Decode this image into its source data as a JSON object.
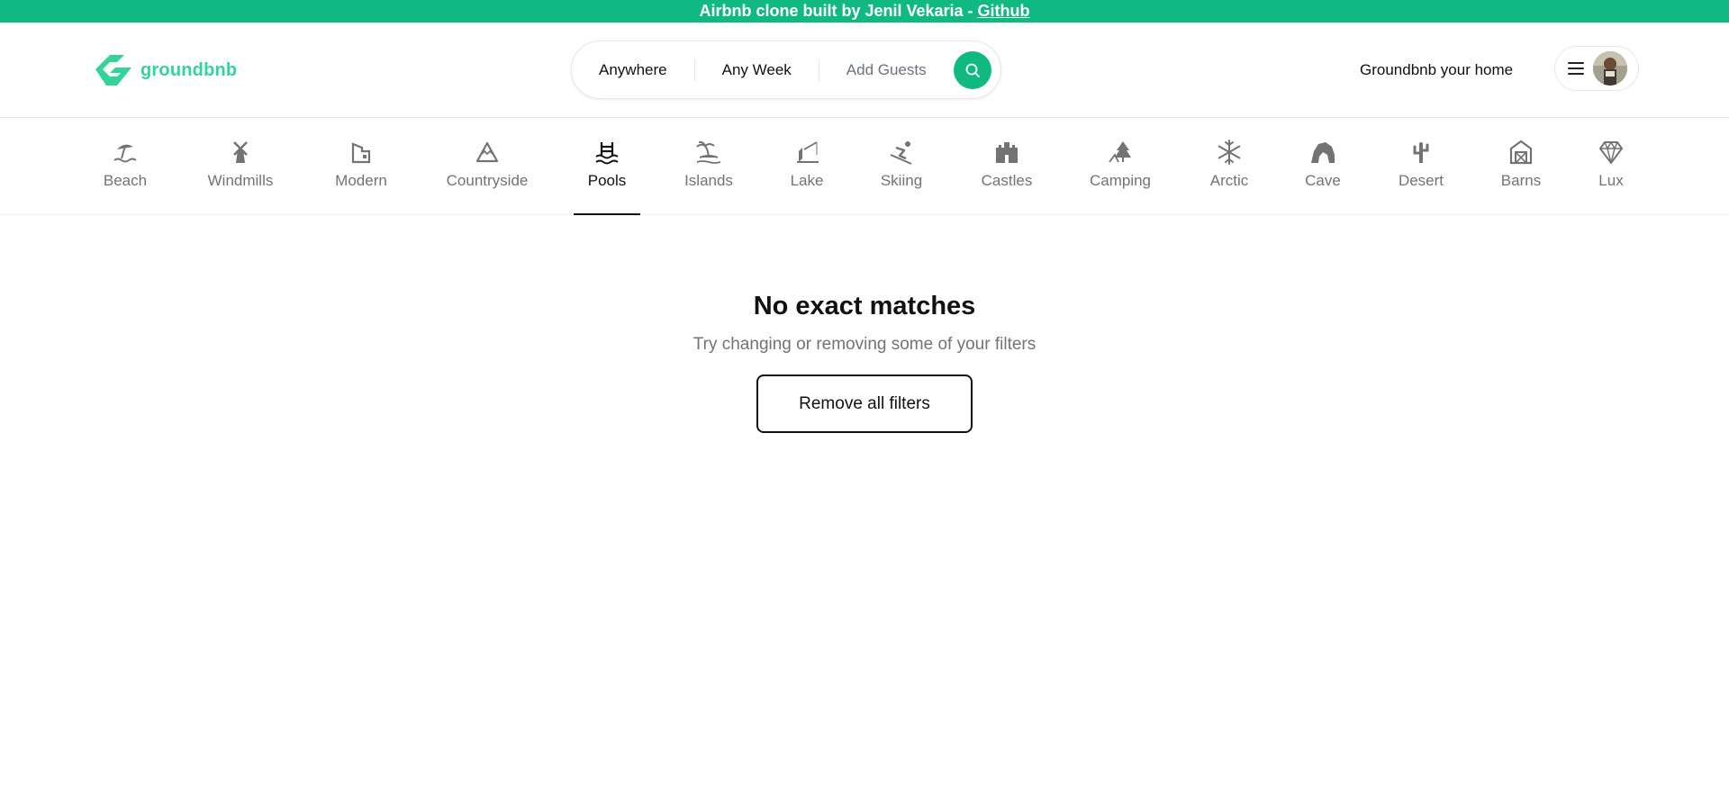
{
  "banner": {
    "text": "Airbnb clone built by Jenil Vekaria - ",
    "link_label": "Github"
  },
  "navbar": {
    "logo_text": "groundbnb",
    "search": {
      "location": "Anywhere",
      "week": "Any Week",
      "guests": "Add Guests",
      "button_icon": "search-icon"
    },
    "host_link": "Groundbnb your home",
    "menu_icon": "hamburger-menu-icon",
    "avatar": "user-avatar"
  },
  "categories": [
    {
      "label": "Beach",
      "icon": "beach-umbrella-icon"
    },
    {
      "label": "Windmills",
      "icon": "windmill-icon"
    },
    {
      "label": "Modern",
      "icon": "modern-building-icon"
    },
    {
      "label": "Countryside",
      "icon": "mountain-icon"
    },
    {
      "label": "Pools",
      "icon": "pool-ladder-icon",
      "active": true
    },
    {
      "label": "Islands",
      "icon": "island-palm-icon"
    },
    {
      "label": "Lake",
      "icon": "fishing-lake-icon"
    },
    {
      "label": "Skiing",
      "icon": "skier-icon"
    },
    {
      "label": "Castles",
      "icon": "castle-icon"
    },
    {
      "label": "Camping",
      "icon": "camping-tree-icon"
    },
    {
      "label": "Arctic",
      "icon": "snowflake-icon"
    },
    {
      "label": "Cave",
      "icon": "cave-icon"
    },
    {
      "label": "Desert",
      "icon": "cactus-icon"
    },
    {
      "label": "Barns",
      "icon": "barn-icon"
    },
    {
      "label": "Lux",
      "icon": "diamond-icon"
    }
  ],
  "empty_state": {
    "title": "No exact matches",
    "subtitle": "Try changing or removing some of your filters",
    "button_label": "Remove all filters"
  },
  "colors": {
    "brand": "#10b981",
    "logo": "#34d399"
  }
}
